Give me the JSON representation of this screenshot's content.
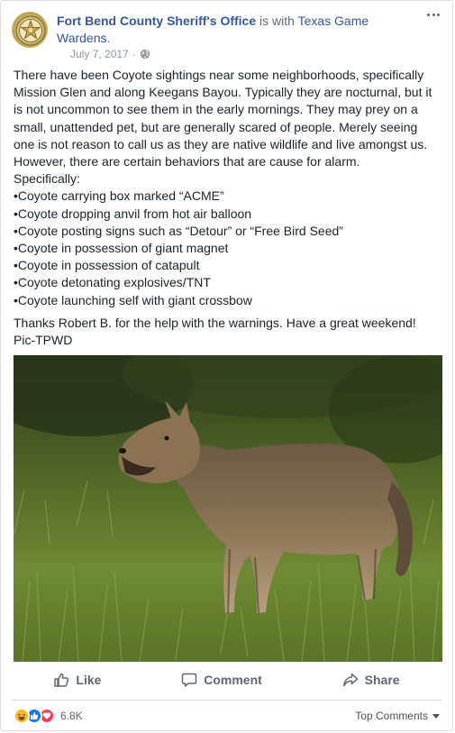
{
  "post": {
    "author": "Fort Bend County Sheriff's Office",
    "with_text": " is with ",
    "with_page": "Texas Game Wardens",
    "with_end": ".",
    "date": "July 7, 2017",
    "separator": "·",
    "privacy_icon": "globe-icon",
    "more_icon": "ellipsis-icon"
  },
  "body": {
    "intro": "There have been Coyote sightings near some neighborhoods, specifically Mission Glen and along Keegans Bayou. Typically they are nocturnal, but it is not uncommon to see them in the early mornings. They may prey on a small, unattended pet, but are generally scared of people. Merely seeing one is not reason to call us as they are native wildlife and live amongst us. However, there are certain behaviors that are cause for alarm.",
    "specifically": "Specifically:",
    "bullets": [
      "Coyote carrying box marked “ACME”",
      "Coyote dropping anvil from hot air balloon",
      "Coyote posting signs such as “Detour” or “Free Bird Seed”",
      "Coyote in possession of giant magnet",
      "Coyote in possession of catapult",
      "Coyote detonating explosives/TNT",
      "Coyote launching self with giant crossbow"
    ],
    "thanks": "Thanks Robert B. for the help with the warnings. Have a great weekend! Pic-TPWD"
  },
  "actions": {
    "like": "Like",
    "comment": "Comment",
    "share": "Share",
    "like_icon": "thumbs-up-icon",
    "comment_icon": "speech-bubble-icon",
    "share_icon": "share-arrow-icon"
  },
  "footer": {
    "reaction_icons": [
      "haha-icon",
      "like-icon",
      "love-icon"
    ],
    "reaction_count": "6.8K",
    "sort_label": "Top Comments"
  },
  "colors": {
    "link": "#365899",
    "meta": "#90949c",
    "action": "#606770",
    "like": "#1877f2",
    "love": "#f33e58",
    "haha": "#f7b928"
  }
}
